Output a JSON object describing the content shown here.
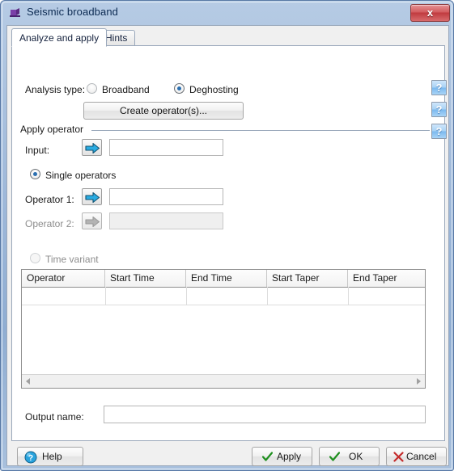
{
  "window": {
    "title": "Seismic broadband",
    "icon": "app-icon",
    "close_label": "x"
  },
  "tabs": [
    {
      "id": "analyze-and-apply",
      "label": "Analyze and apply",
      "active": true
    },
    {
      "id": "hints",
      "label": "Hints",
      "active": false
    }
  ],
  "analysis": {
    "label": "Analysis type:",
    "options": [
      {
        "id": "broadband",
        "label": "Broadband",
        "checked": false
      },
      {
        "id": "deghosting",
        "label": "Deghosting",
        "checked": true
      }
    ],
    "create_button": "Create operator(s)..."
  },
  "apply_operator": {
    "group_title": "Apply operator",
    "input": {
      "label": "Input:",
      "value": "",
      "placeholder": "",
      "browse_icon": "blue-arrow-icon"
    },
    "mode_single": {
      "label": "Single operators",
      "checked": true
    },
    "operator1": {
      "label": "Operator 1:",
      "value": "",
      "placeholder": "",
      "browse_icon": "blue-arrow-icon",
      "enabled": true
    },
    "operator2": {
      "label": "Operator 2:",
      "value": "",
      "placeholder": "",
      "browse_icon": "grey-arrow-icon",
      "enabled": false
    },
    "mode_time_variant": {
      "label": "Time variant",
      "checked": false
    }
  },
  "table": {
    "columns": [
      "Operator",
      "Start Time",
      "End Time",
      "Start Taper",
      "End Taper"
    ],
    "rows": [],
    "scrollbar": {
      "left_arrow": "scroll-left-icon",
      "right_arrow": "scroll-right-icon"
    }
  },
  "output": {
    "label": "Output  name:",
    "value": "",
    "placeholder": ""
  },
  "help_buttons": [
    {
      "id": "help-analysis",
      "label": "?"
    },
    {
      "id": "help-create",
      "label": "?"
    },
    {
      "id": "help-apply",
      "label": "?"
    }
  ],
  "footer": {
    "help": {
      "label": "Help",
      "icon": "question-circle-icon"
    },
    "apply": {
      "label": "Apply",
      "icon": "check-icon"
    },
    "ok": {
      "label": "OK",
      "icon": "check-icon"
    },
    "cancel": {
      "label": "Cancel",
      "icon": "cross-icon"
    }
  },
  "colors": {
    "title_gradient_top": "#b6cbe4",
    "accent_blue": "#2b6fb0",
    "arrow_blue": "#29abe2",
    "arrow_grey": "#8e8e8e",
    "check_green": "#1e8f1e",
    "cancel_red": "#c42b2b",
    "close_red": "#c03b3f",
    "help_blue": "#29a3dd"
  }
}
